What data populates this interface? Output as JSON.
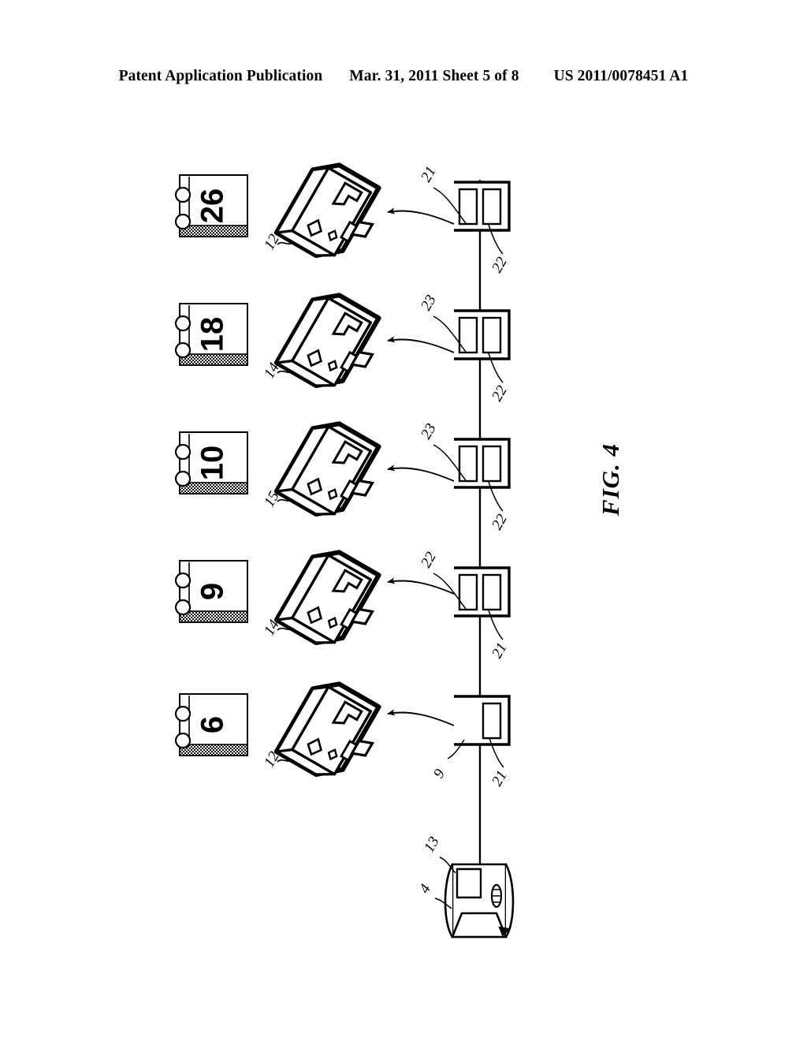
{
  "header": {
    "left": "Patent Application Publication",
    "middle": "Mar. 31, 2011  Sheet 5 of 8",
    "right": "US 2011/0078451 A1"
  },
  "figure": {
    "caption": "FIG. 4",
    "orientation_note": "drawing rotated 90 degrees counter-clockwise",
    "colors": {
      "ink": "#000000",
      "paper": "#ffffff",
      "shadow_band": "#1a1a1a"
    },
    "rows": [
      {
        "id": "row-1",
        "page_number": "6",
        "printer_ref": "12",
        "node_refs": [
          "9",
          "21"
        ],
        "node_inner_count": 1
      },
      {
        "id": "row-2",
        "page_number": "9",
        "printer_ref": "14",
        "node_refs": [
          "22",
          "21"
        ],
        "node_inner_count": 2
      },
      {
        "id": "row-3",
        "page_number": "10",
        "printer_ref": "15",
        "node_refs": [
          "23",
          "22"
        ],
        "node_inner_count": 2
      },
      {
        "id": "row-4",
        "page_number": "18",
        "printer_ref": "14",
        "node_refs": [
          "23",
          "22"
        ],
        "node_inner_count": 2
      },
      {
        "id": "row-5",
        "page_number": "26",
        "printer_ref": "12",
        "node_refs": [
          "21",
          "22"
        ],
        "node_inner_count": 2
      }
    ],
    "source_device": {
      "name": "scanner-device",
      "refs": [
        "13",
        "4"
      ]
    }
  }
}
